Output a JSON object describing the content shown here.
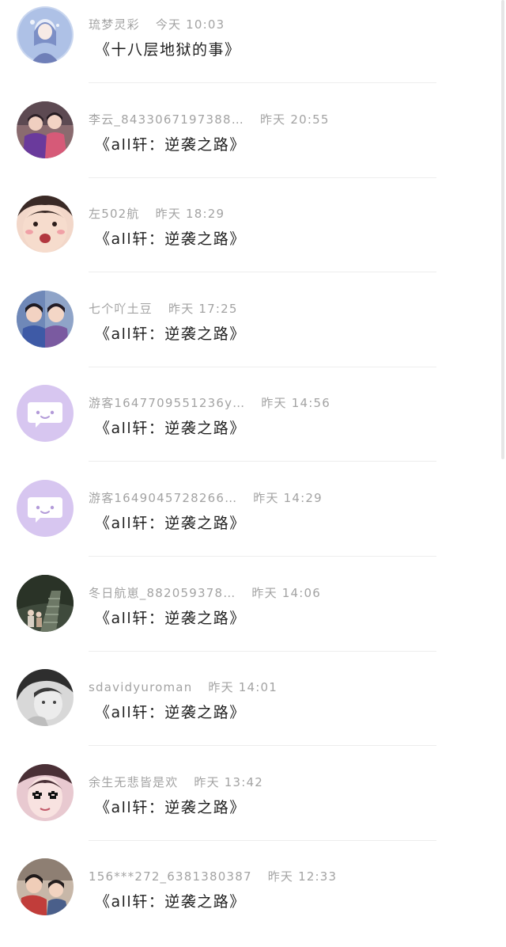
{
  "comments": [
    {
      "user": "琉梦灵彩",
      "time": "今天 10:03",
      "text": "《十八层地狱的事》",
      "avatar": "anime-girl-avatar"
    },
    {
      "user": "李云_8433067197388…",
      "time": "昨天 20:55",
      "text": "《all轩：逆袭之路》",
      "avatar": "two-girls-avatar"
    },
    {
      "user": "左502航",
      "time": "昨天 18:29",
      "text": "《all轩：逆袭之路》",
      "avatar": "boy-face-avatar"
    },
    {
      "user": "七个吖土豆",
      "time": "昨天 17:25",
      "text": "《all轩：逆袭之路》",
      "avatar": "two-boys-avatar"
    },
    {
      "user": "游客1647709551236y…",
      "time": "昨天 14:56",
      "text": "《all轩：逆袭之路》",
      "avatar": "default-chat-avatar"
    },
    {
      "user": "游客1649045728266…",
      "time": "昨天 14:29",
      "text": "《all轩：逆袭之路》",
      "avatar": "default-chat-avatar"
    },
    {
      "user": "冬日航崽_882059378…",
      "time": "昨天 14:06",
      "text": "《all轩：逆袭之路》",
      "avatar": "stairs-photo-avatar"
    },
    {
      "user": "sdavidyuroman",
      "time": "昨天 14:01",
      "text": "《all轩：逆袭之路》",
      "avatar": "bw-portrait-avatar"
    },
    {
      "user": "余生无悲皆是欢",
      "time": "昨天 13:42",
      "text": "《all轩：逆袭之路》",
      "avatar": "girl-mosaic-avatar"
    },
    {
      "user": "156***272_6381380387",
      "time": "昨天 12:33",
      "text": "《all轩：逆袭之路》",
      "avatar": "people-photo-avatar"
    }
  ],
  "colors": {
    "username": "#a3a3a3",
    "message": "#1f1f1f",
    "default_avatar_bg": "#d7c6f0",
    "divider": "#ededed"
  }
}
